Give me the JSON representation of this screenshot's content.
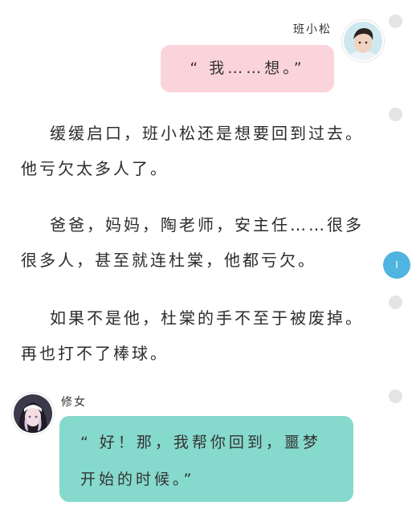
{
  "dialogue": [
    {
      "speaker": "班小松",
      "text": "“ 我……想。”",
      "bubble_color": "#fbd4db"
    },
    {
      "speaker": "修女",
      "text": "“ 好！那，我帮你回到，噩梦开始的时候。”",
      "bubble_color": "#86d9cd"
    }
  ],
  "narration": [
    "缓缓启口，班小松还是想要回到过去。他亏欠太多人了。",
    "爸爸，妈妈，陶老师，安主任……很多很多人，甚至就连杜棠，他都亏欠。",
    "如果不是他，杜棠的手不至于被废掉。再也打不了棒球。"
  ],
  "scroll_rail": {
    "current_marker": "I",
    "marker_color": "#4fb5e0"
  },
  "icons": {
    "speaker1_avatar": "boy-portrait-avatar",
    "speaker2_avatar": "nun-portrait-avatar"
  }
}
